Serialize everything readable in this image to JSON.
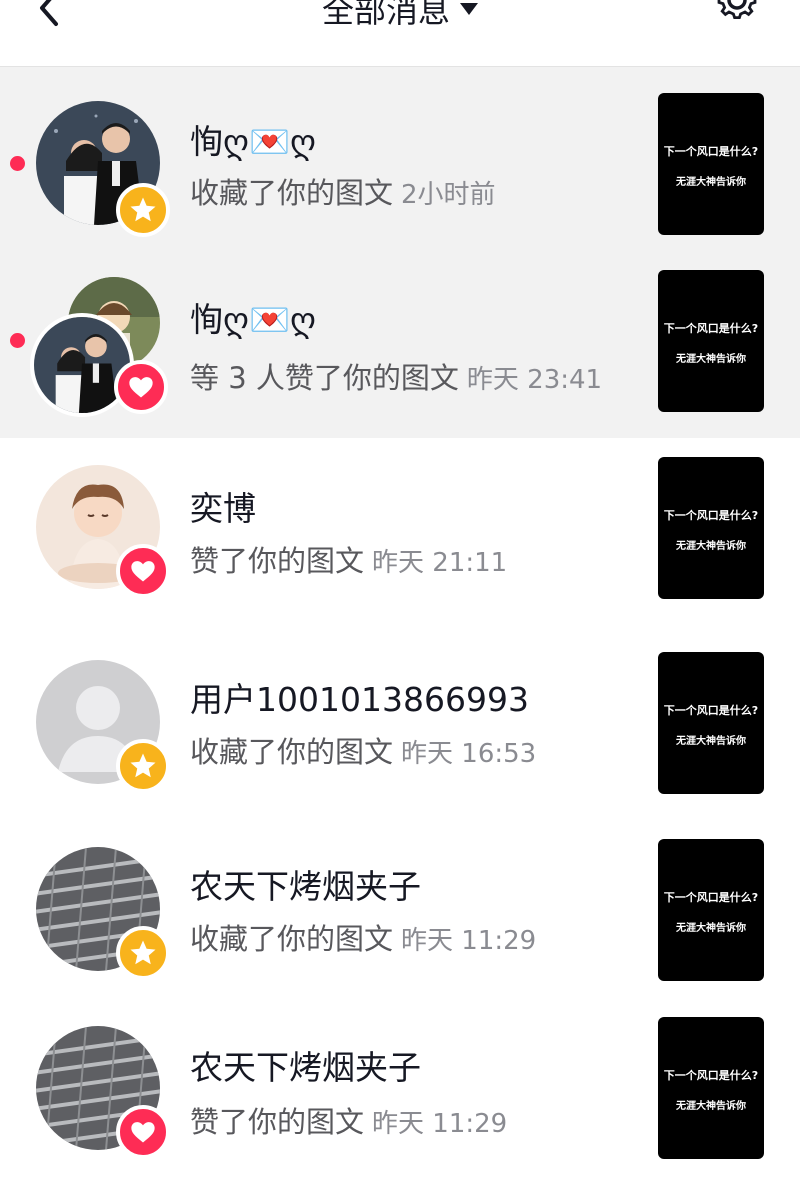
{
  "header": {
    "title": "全部消息",
    "back_icon": "chevron-left-icon",
    "dropdown_icon": "caret-down-icon",
    "settings_icon": "gear-icon"
  },
  "colors": {
    "unread_background": "#f2f2f2",
    "unread_dot": "#fe2c55",
    "star_badge": "#f8b31c",
    "heart_badge": "#fe2c55"
  },
  "notifications": [
    {
      "name": "恂ღ💌ღ",
      "action": "收藏了你的图文",
      "time": "2小时前",
      "badge": "star-icon",
      "unread": true,
      "thumbnail": {
        "line1": "下一个风口是什么?",
        "line2": "无涯大神告诉你"
      }
    },
    {
      "name": "恂ღ💌ღ",
      "action": "等 3 人赞了你的图文",
      "time": "昨天 23:41",
      "badge": "heart-icon",
      "unread": true,
      "thumbnail": {
        "line1": "下一个风口是什么?",
        "line2": "无涯大神告诉你"
      }
    },
    {
      "name": "奕博",
      "action": "赞了你的图文",
      "time": "昨天 21:11",
      "badge": "heart-icon",
      "unread": false,
      "thumbnail": {
        "line1": "下一个风口是什么?",
        "line2": "无涯大神告诉你"
      }
    },
    {
      "name": "用户1001013866993",
      "action": "收藏了你的图文",
      "time": "昨天 16:53",
      "badge": "star-icon",
      "unread": false,
      "thumbnail": {
        "line1": "下一个风口是什么?",
        "line2": "无涯大神告诉你"
      }
    },
    {
      "name": "农天下烤烟夹子",
      "action": "收藏了你的图文",
      "time": "昨天 11:29",
      "badge": "star-icon",
      "unread": false,
      "thumbnail": {
        "line1": "下一个风口是什么?",
        "line2": "无涯大神告诉你"
      }
    },
    {
      "name": "农天下烤烟夹子",
      "action": "赞了你的图文",
      "time": "昨天 11:29",
      "badge": "heart-icon",
      "unread": false,
      "thumbnail": {
        "line1": "下一个风口是什么?",
        "line2": "无涯大神告诉你"
      }
    }
  ]
}
